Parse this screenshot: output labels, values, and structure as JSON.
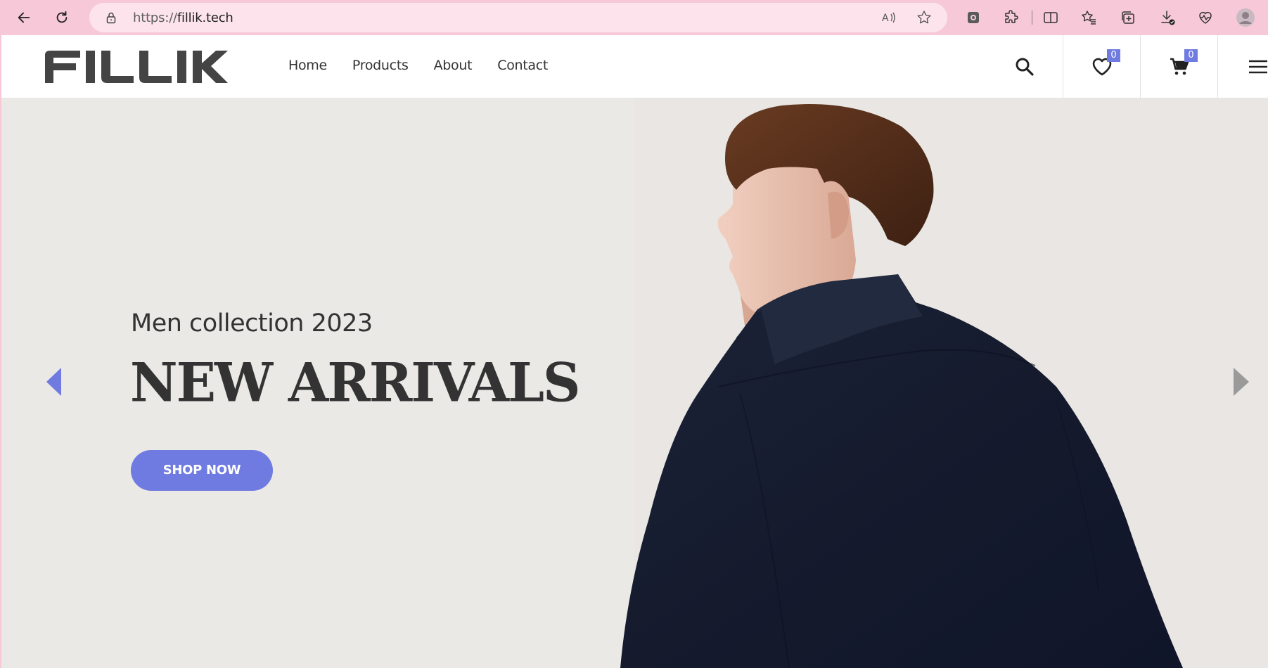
{
  "browser": {
    "url_scheme": "https://",
    "url_host": "fillik.tech",
    "icons": [
      "back-icon",
      "refresh-icon",
      "lock-icon",
      "read-aloud-icon",
      "favorite-star-icon",
      "extension-square-icon",
      "extensions-puzzle-icon",
      "split-screen-icon",
      "favorites-icon",
      "collections-icon",
      "downloads-icon",
      "heartbeat-icon",
      "profile-avatar-icon"
    ]
  },
  "site": {
    "logo_text": "FILLIK",
    "nav": [
      "Home",
      "Products",
      "About",
      "Contact"
    ],
    "wishlist_count": "0",
    "cart_count": "0",
    "accent_color": "#6f7be0"
  },
  "hero": {
    "subtitle": "Men collection 2023",
    "title": "NEW ARRIVALS",
    "cta_label": "SHOP NOW"
  }
}
